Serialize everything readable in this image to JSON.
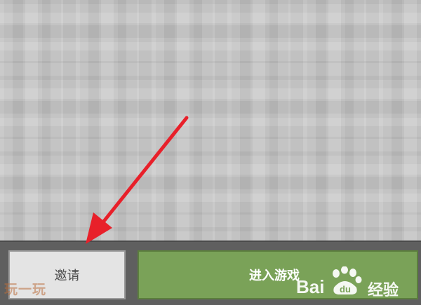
{
  "screen": {
    "background": "minecraft-stone-texture"
  },
  "buttons": {
    "invite_label": "邀请",
    "enter_game_label": "进入游戏"
  },
  "watermarks": {
    "left_text": "玩一玩",
    "baidu_text": "Bai",
    "baidu_du": "du",
    "baidu_jingyan": "经验"
  },
  "annotation": {
    "arrow_color": "#e8202a",
    "arrow_points_to": "invite-button"
  },
  "colors": {
    "enter_button": "#7aa258",
    "invite_button": "#e4e4e4",
    "bottom_bar": "#5f5f5f"
  }
}
